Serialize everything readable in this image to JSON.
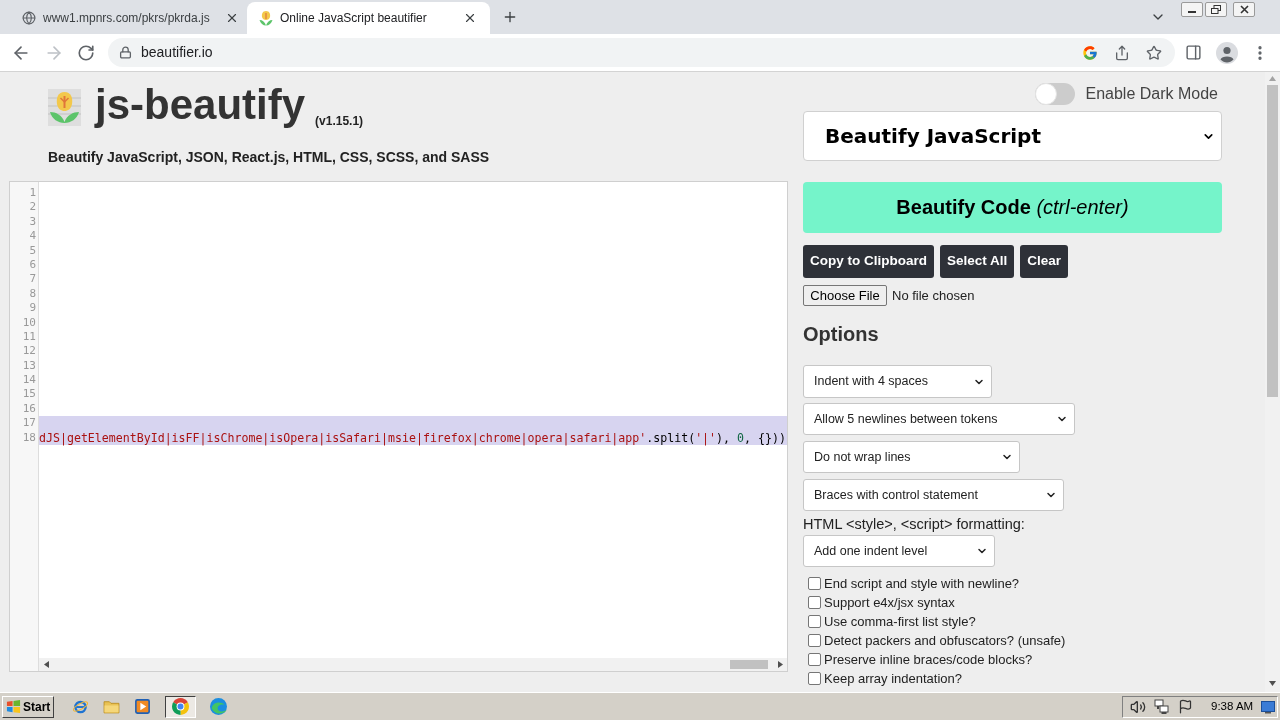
{
  "browser": {
    "tabs": [
      {
        "title": "www1.mpnrs.com/pkrs/pkrda.js",
        "selected": false
      },
      {
        "title": "Online JavaScript beautifier",
        "selected": true
      }
    ],
    "address": "beautifier.io"
  },
  "header": {
    "title": "js-beautify",
    "version": "(v1.15.1)",
    "subtitle": "Beautify JavaScript, JSON, React.js, HTML, CSS, SCSS, and SASS"
  },
  "editor": {
    "lines": [
      {
        "number": "1",
        "highlighted": false
      },
      {
        "number": "2",
        "highlighted": false
      },
      {
        "number": "3",
        "highlighted": false
      },
      {
        "number": "4",
        "highlighted": false
      },
      {
        "number": "5",
        "highlighted": false
      },
      {
        "number": "6",
        "highlighted": false
      },
      {
        "number": "7",
        "highlighted": false
      },
      {
        "number": "8",
        "highlighted": false
      },
      {
        "number": "9",
        "highlighted": false
      },
      {
        "number": "10",
        "highlighted": false
      },
      {
        "number": "11",
        "highlighted": false
      },
      {
        "number": "12",
        "highlighted": false
      },
      {
        "number": "13",
        "highlighted": false
      },
      {
        "number": "14",
        "highlighted": false
      },
      {
        "number": "15",
        "highlighted": false
      },
      {
        "number": "16",
        "highlighted": false
      },
      {
        "number": "17",
        "highlighted": true
      },
      {
        "number": "18",
        "highlighted": true,
        "tokens": [
          {
            "kind": "string",
            "text": "dJS|getElementById|isFF|isChrome|isOpera|isSafari|msie|firefox|chrome|opera|safari|app'"
          },
          {
            "kind": "plain",
            "text": ".split("
          },
          {
            "kind": "string",
            "text": "'|'"
          },
          {
            "kind": "plain",
            "text": "), "
          },
          {
            "kind": "number",
            "text": "0"
          },
          {
            "kind": "plain",
            "text": ", {}))"
          }
        ]
      }
    ]
  },
  "dark_mode": {
    "label": "Enable Dark Mode",
    "on": false
  },
  "language_select": {
    "value": "Beautify JavaScript"
  },
  "beautify_button": {
    "label": "**Beautify Code** *(ctrl-enter)*"
  },
  "action_buttons": [
    "Copy to Clipboard",
    "Select All",
    "Clear"
  ],
  "file_input": {
    "button": "Choose File",
    "status": "No file chosen"
  },
  "options": {
    "heading": "Options",
    "selects": [
      "Indent with 4 spaces",
      "Allow 5 newlines between tokens",
      "Do not wrap lines",
      "Braces with control statement"
    ],
    "html_label": "HTML <style>, <script> formatting:",
    "html_select": "Add one indent level",
    "checkboxes": [
      {
        "label": "End script and style with newline?",
        "checked": false
      },
      {
        "label": "Support e4x/jsx syntax",
        "checked": false
      },
      {
        "label": "Use comma-first list style?",
        "checked": false
      },
      {
        "label": "Detect packers and obfuscators? (unsafe)",
        "checked": false
      },
      {
        "label": "Preserve inline braces/code blocks?",
        "checked": false
      },
      {
        "label": "Keep array indentation?",
        "checked": false
      }
    ]
  },
  "taskbar": {
    "start": "Start",
    "apps": [
      {
        "selected": false
      },
      {
        "selected": false
      },
      {
        "selected": false
      },
      {
        "selected": true
      },
      {
        "selected": false
      }
    ],
    "clock": "9:38 AM"
  }
}
